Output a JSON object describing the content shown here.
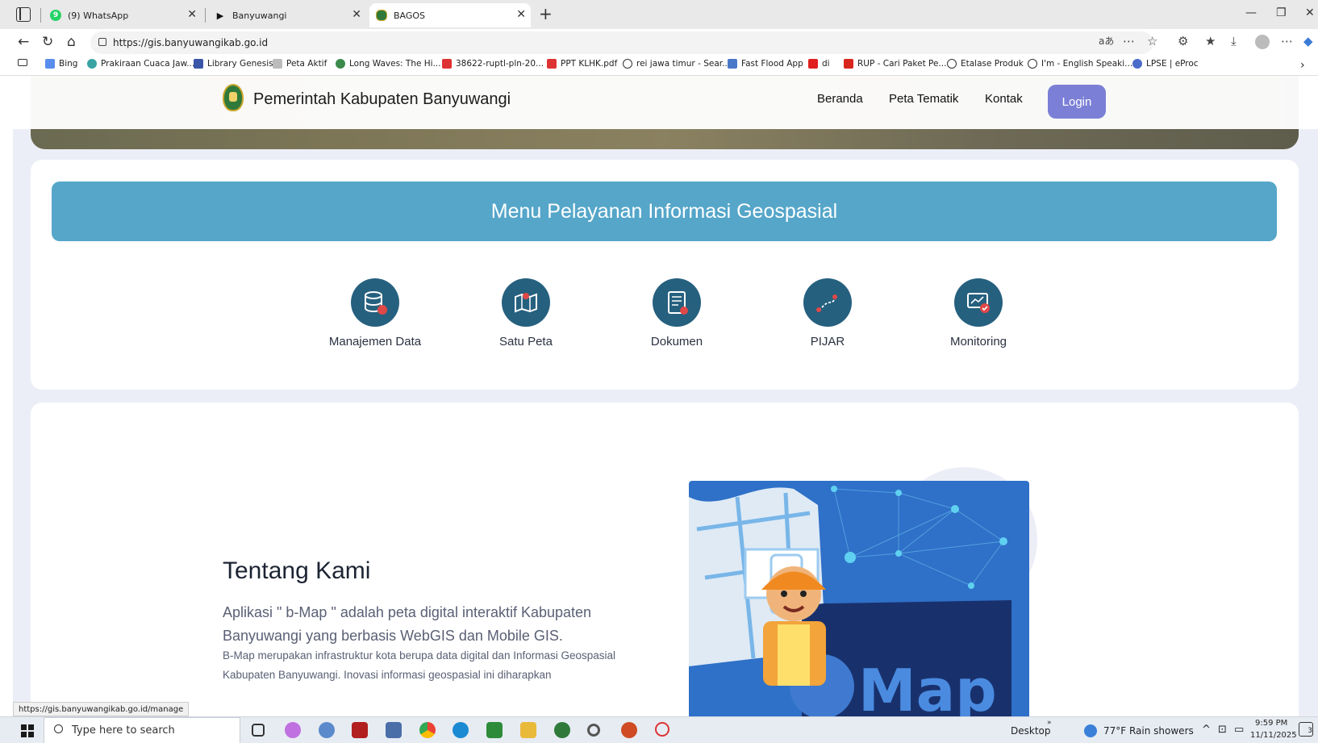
{
  "browser": {
    "tabs": [
      {
        "title": "(9) WhatsApp",
        "badge": "9",
        "active": false
      },
      {
        "title": "Banyuwangi",
        "active": false
      },
      {
        "title": "BAGOS",
        "active": true
      }
    ],
    "url": "https://gis.banyuwangikab.go.id",
    "bookmarks": [
      "Bing",
      "Prakiraan Cuaca Jaw...",
      "Library Genesis",
      "Peta Aktif",
      "Long Waves: The Hi...",
      "38622-ruptl-pln-20...",
      "PPT KLHK.pdf",
      "rei jawa timur - Sear...",
      "Fast Flood App",
      "di",
      "RUP - Cari Paket Pe...",
      "Etalase Produk",
      "I'm - English Speaki...",
      "LPSE | eProc"
    ],
    "status_url": "https://gis.banyuwangikab.go.id/manage"
  },
  "site": {
    "title": "Pemerintah Kabupaten Banyuwangi",
    "nav": [
      "Beranda",
      "Peta Tematik",
      "Kontak"
    ],
    "login_label": "Login",
    "menu_title": "Menu Pelayanan Informasi Geospasial",
    "services": [
      {
        "label": "Manajemen Data",
        "icon": "database-icon"
      },
      {
        "label": "Satu Peta",
        "icon": "map-pin-icon"
      },
      {
        "label": "Dokumen",
        "icon": "document-icon"
      },
      {
        "label": "PIJAR",
        "icon": "route-icon"
      },
      {
        "label": "Monitoring",
        "icon": "monitor-check-icon"
      }
    ],
    "about": {
      "title": "Tentang Kami",
      "lead": "Aplikasi \" b-Map \" adalah peta digital interaktif Kabupaten Banyuwangi yang berbasis WebGIS dan Mobile GIS.",
      "body": "B-Map merupakan infrastruktur kota berupa data digital dan Informasi Geospasial Kabupaten Banyuwangi. Inovasi informasi geospasial ini diharapkan",
      "image_text": "Map"
    }
  },
  "taskbar": {
    "search_placeholder": "Type here to search",
    "desktop_label": "Desktop",
    "weather": "77°F  Rain showers",
    "time": "9:59 PM",
    "date": "11/11/2025",
    "notif_count": "3"
  },
  "colors": {
    "accent_banner": "#55a6c9",
    "login": "#7b7fd6",
    "icon_circle": "#26607f"
  }
}
